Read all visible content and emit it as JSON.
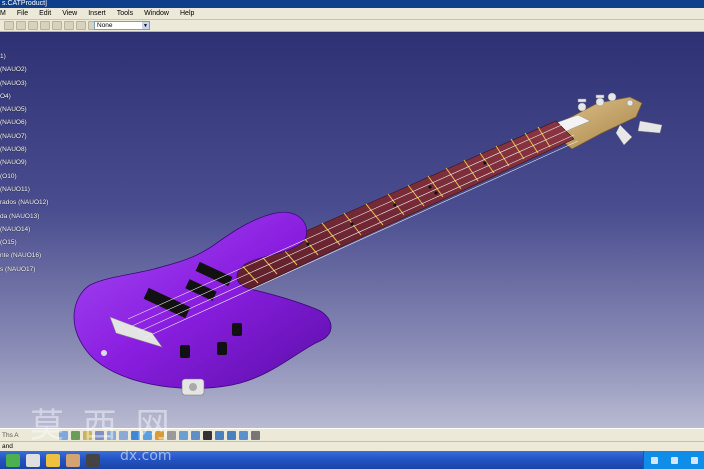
{
  "window": {
    "title": "s.CATProduct]"
  },
  "menu": [
    "M",
    "File",
    "Edit",
    "View",
    "Insert",
    "Tools",
    "Window",
    "Help"
  ],
  "toolbar": {
    "combo_value": "None"
  },
  "tree": [
    "1)",
    "(NAUO2)",
    "(NAUO3)",
    "O4)",
    "(NAUO5)",
    "(NAUO6)",
    "(NAUO7)",
    "(NAUO8)",
    "(NAUO9)",
    "(O10)",
    "(NAUO11)",
    "rados (NAUO12)",
    "da (NAUO13)",
    "(NAUO14)",
    "(O15)",
    "nte (NAUO16)",
    "s (NAUO17)"
  ],
  "bottombar": {
    "label": "Ths A"
  },
  "statusbar": {
    "text": "and"
  },
  "watermark": {
    "chars": "莫 西 网",
    "url": "dx.com"
  },
  "colors": {
    "body": "#8a1ee0",
    "neck": "#7b2a35",
    "headstock": "#c9a56a",
    "background_top": "#2e3173"
  }
}
